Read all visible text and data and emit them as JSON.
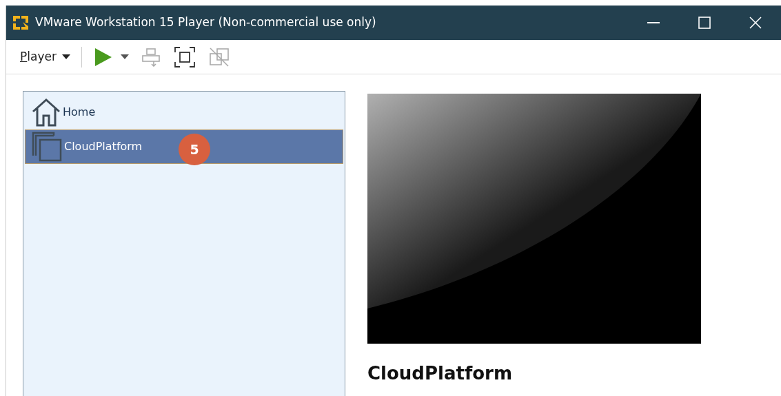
{
  "window": {
    "title": "VMware Workstation 15 Player (Non-commercial use only)"
  },
  "toolbar": {
    "menu": "Player"
  },
  "library": [
    {
      "label": "Home",
      "kind": "home",
      "selected": false
    },
    {
      "label": "CloudPlatform",
      "kind": "vm",
      "selected": true,
      "badge": "5"
    }
  ],
  "details": {
    "name": "CloudPlatform"
  }
}
